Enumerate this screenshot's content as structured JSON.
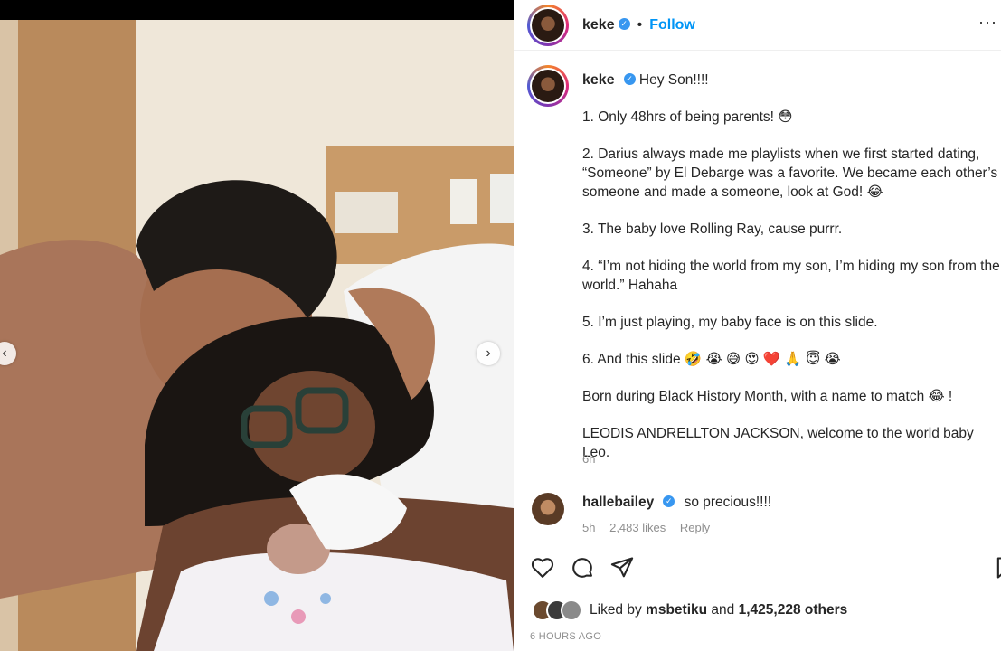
{
  "post": {
    "username": "keke",
    "follow_label": "Follow",
    "separator": "•",
    "more_label": "···"
  },
  "caption": {
    "username": "keke",
    "intro": "Hey Son!!!!",
    "lines": [
      "1. Only 48hrs of being parents! 😳",
      "2. Darius always made me playlists when we first started dating, “Someone” by El Debarge was a favorite. We became each other’s someone and made a someone, look at God! 😂",
      "3. The baby love Rolling Ray, cause purrr.",
      "4. “I’m not hiding the world from my son, I’m hiding my son from the world.” Hahaha",
      "5. I’m just playing, my baby face is on this slide.",
      "6. And this slide 🤣 😭 😅 😍 ❤️ 🙏 😇 😭",
      "Born during Black History Month, with a name to match 😂 !",
      "LEODIS ANDRELLTON JACKSON, welcome to the world baby Leo."
    ],
    "time": "6h"
  },
  "comment": {
    "username": "hallebailey",
    "text": "so precious!!!!",
    "time": "5h",
    "likes": "2,483 likes",
    "reply_label": "Reply"
  },
  "likes": {
    "prefix": "Liked by",
    "user": "msbetiku",
    "conj": "and",
    "count": "1,425,228 others"
  },
  "post_time": "6 HOURS AGO",
  "icons": {
    "prev": "chevron-left-icon",
    "next": "chevron-right-icon",
    "like": "heart-icon",
    "comment": "comment-icon",
    "share": "share-icon",
    "save": "bookmark-icon",
    "verified": "verified-badge-icon"
  },
  "colors": {
    "accent": "#0095f6",
    "verified": "#3897f0",
    "muted": "#8e8e8e",
    "text": "#262626"
  }
}
